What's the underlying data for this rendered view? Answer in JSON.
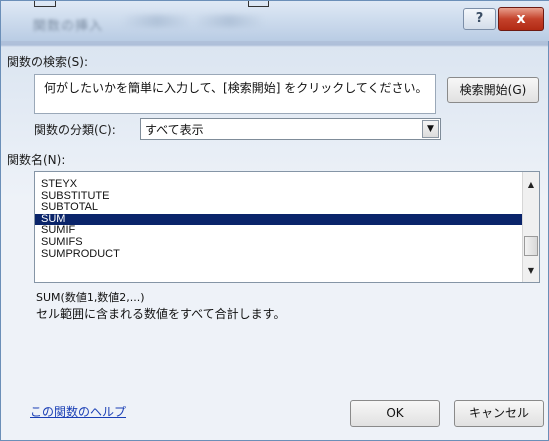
{
  "window": {
    "title": "関数の挿入",
    "help_label": "?",
    "close_label": "x"
  },
  "search": {
    "label": "関数の検索(S):",
    "value": "何がしたいかを簡単に入力して、[検索開始] をクリックしてください。",
    "button_label": "検索開始(G)"
  },
  "category": {
    "label": "関数の分類(C):",
    "selected": "すべて表示"
  },
  "function_list": {
    "label": "関数名(N):",
    "items": [
      "STEYX",
      "SUBSTITUTE",
      "SUBTOTAL",
      "SUM",
      "SUMIF",
      "SUMIFS",
      "SUMPRODUCT"
    ],
    "selected": "SUM"
  },
  "description": {
    "syntax": "SUM(数値1,数値2,...)",
    "text": "セル範囲に含まれる数値をすべて合計します。"
  },
  "footer": {
    "help_link": "この関数のヘルプ",
    "ok_label": "OK",
    "cancel_label": "キャンセル"
  },
  "colors": {
    "selection": "#0a246a",
    "close_button": "#c4422b",
    "link": "#1a3fb5"
  }
}
